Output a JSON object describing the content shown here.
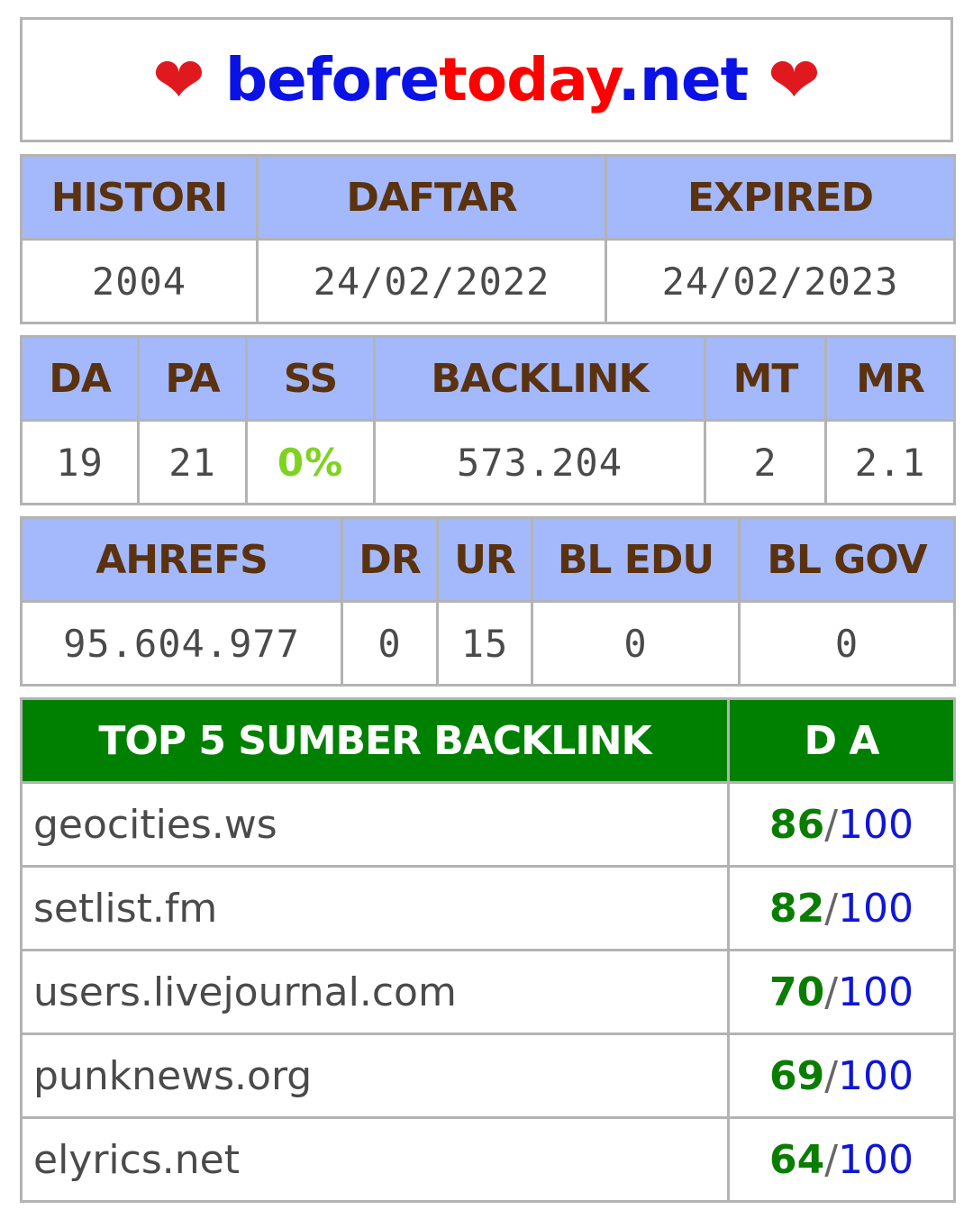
{
  "site": {
    "heart": "❤",
    "part1": "before",
    "part2": "today",
    "part3": ".net"
  },
  "dates": {
    "headers": [
      "HISTORI",
      "DAFTAR",
      "EXPIRED"
    ],
    "values": [
      "2004",
      "24/02/2022",
      "24/02/2023"
    ]
  },
  "moz": {
    "headers": [
      "DA",
      "PA",
      "SS",
      "BACKLINK",
      "MT",
      "MR"
    ],
    "values": [
      "19",
      "21",
      "0%",
      "573.204",
      "2",
      "2.1"
    ]
  },
  "ahrefs": {
    "headers": [
      "AHREFS",
      "DR",
      "UR",
      "BL EDU",
      "BL GOV"
    ],
    "values": [
      "95.604.977",
      "0",
      "15",
      "0",
      "0"
    ]
  },
  "top": {
    "header_source": "TOP 5 SUMBER BACKLINK",
    "header_da": "D A",
    "rows": [
      {
        "domain": "geocities.ws",
        "da": "86",
        "max": "100"
      },
      {
        "domain": "setlist.fm",
        "da": "82",
        "max": "100"
      },
      {
        "domain": "users.livejournal.com",
        "da": "70",
        "max": "100"
      },
      {
        "domain": "punknews.org",
        "da": "69",
        "max": "100"
      },
      {
        "domain": "elyrics.net",
        "da": "64",
        "max": "100"
      }
    ]
  },
  "colors": {
    "header_bg": "#a4b9fb",
    "header_text": "#5a3210",
    "top_header_bg": "#008000",
    "site_blue": "#0b12e6",
    "site_red": "#ff0000",
    "ss_green": "#7ed321"
  }
}
